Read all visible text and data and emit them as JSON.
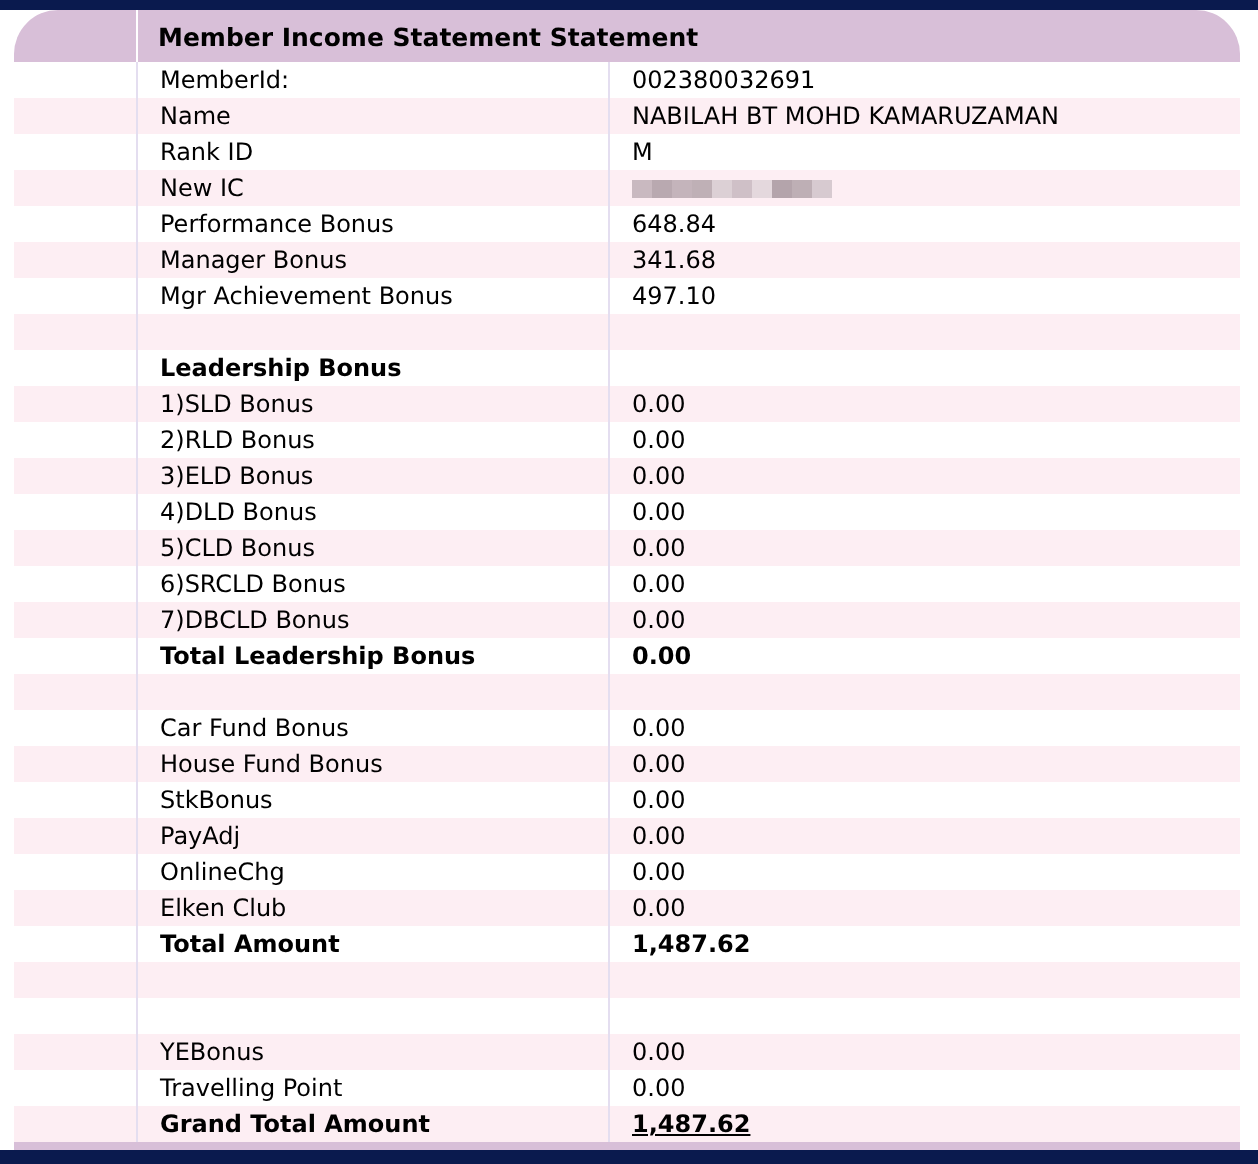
{
  "title": "Member Income Statement Statement",
  "rows": [
    {
      "kind": "item",
      "label": "MemberId:",
      "value": "002380032691"
    },
    {
      "kind": "item",
      "label": "Name",
      "value": "NABILAH BT MOHD KAMARUZAMAN"
    },
    {
      "kind": "item",
      "label": "Rank ID",
      "value": "M"
    },
    {
      "kind": "redacted",
      "label": "New IC"
    },
    {
      "kind": "item",
      "label": "Performance Bonus",
      "value": "648.84"
    },
    {
      "kind": "item",
      "label": "Manager Bonus",
      "value": "341.68"
    },
    {
      "kind": "item",
      "label": "Mgr Achievement Bonus",
      "value": "497.10"
    },
    {
      "kind": "blank"
    },
    {
      "kind": "heading",
      "label": "Leadership Bonus"
    },
    {
      "kind": "item",
      "label": "1)SLD Bonus",
      "value": "0.00"
    },
    {
      "kind": "item",
      "label": "2)RLD Bonus",
      "value": "0.00"
    },
    {
      "kind": "item",
      "label": "3)ELD Bonus",
      "value": "0.00"
    },
    {
      "kind": "item",
      "label": "4)DLD Bonus",
      "value": "0.00"
    },
    {
      "kind": "item",
      "label": "5)CLD Bonus",
      "value": "0.00"
    },
    {
      "kind": "item",
      "label": "6)SRCLD Bonus",
      "value": "0.00"
    },
    {
      "kind": "item",
      "label": "7)DBCLD Bonus",
      "value": "0.00"
    },
    {
      "kind": "total",
      "label": "Total Leadership Bonus",
      "value": "0.00"
    },
    {
      "kind": "blank"
    },
    {
      "kind": "item",
      "label": "Car Fund Bonus",
      "value": "0.00"
    },
    {
      "kind": "item",
      "label": "House Fund Bonus",
      "value": "0.00"
    },
    {
      "kind": "item",
      "label": "StkBonus",
      "value": "0.00"
    },
    {
      "kind": "item",
      "label": "PayAdj",
      "value": "0.00"
    },
    {
      "kind": "item",
      "label": "OnlineChg",
      "value": "0.00"
    },
    {
      "kind": "item",
      "label": "Elken Club",
      "value": "0.00"
    },
    {
      "kind": "total",
      "label": "Total Amount",
      "value": "1,487.62"
    },
    {
      "kind": "blank"
    },
    {
      "kind": "blank"
    },
    {
      "kind": "item",
      "label": "YEBonus",
      "value": "0.00"
    },
    {
      "kind": "item",
      "label": "Travelling Point",
      "value": "0.00"
    },
    {
      "kind": "grand_total",
      "label": "Grand Total Amount",
      "value": "1,487.62"
    }
  ]
}
